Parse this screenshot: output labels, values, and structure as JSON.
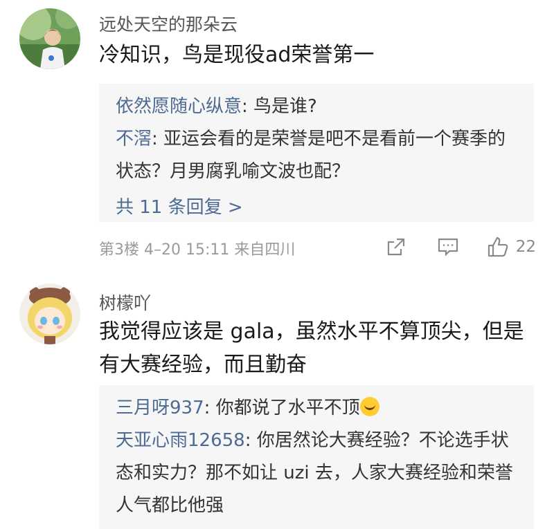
{
  "comments": [
    {
      "username": "远处天空的那朵云",
      "content": "冷知识，鸟是现役ad荣誉第一",
      "replies": [
        {
          "user": "依然愿随心纵意",
          "text": ": 鸟是谁?"
        },
        {
          "user": "不滘",
          "text": ": 亚运会看的是荣誉是吧不是看前一个赛季的状态？月男腐乳喻文波也配？"
        }
      ],
      "more_replies": "共 11 条回复 >",
      "meta": "第3楼  4–20 15:11  来自四川",
      "like_count": "22"
    },
    {
      "username": "树檬吖",
      "content": "我觉得应该是 gala，虽然水平不算顶尖，但是有大赛经验，而且勤奋",
      "replies": [
        {
          "user": "三月呀937",
          "text": ": 你都说了水平不顶"
        },
        {
          "user": "天亚心雨12658",
          "text": ": 你居然论大赛经验？不论选手状态和实力？那不如让 uzi 去，人家大赛经验和荣誉人气都比他强"
        }
      ]
    }
  ],
  "icons": {
    "share": "share-icon",
    "comment": "comment-icon",
    "like": "thumbs-up-icon"
  },
  "colors": {
    "link": "#4c6a93",
    "reply_bg": "#f6f6f6"
  }
}
